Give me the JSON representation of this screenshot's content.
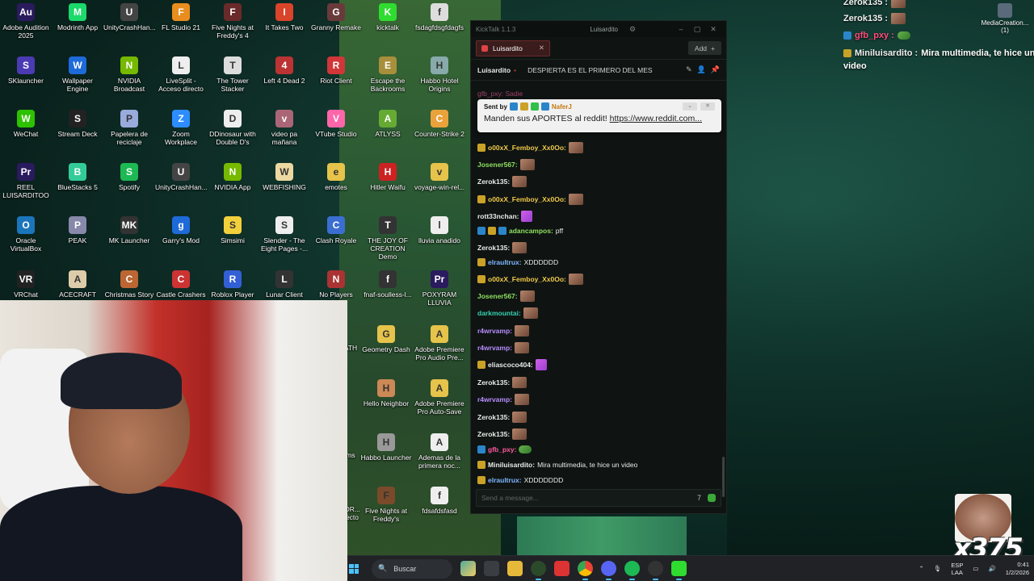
{
  "desktop": {
    "icons": [
      {
        "label": "Adobe Audition 2025",
        "color": "#2a1a5e",
        "glyph": "Au"
      },
      {
        "label": "Modrinth App",
        "color": "#1bd96a",
        "glyph": "M"
      },
      {
        "label": "UnityCrashHan...",
        "color": "#444",
        "glyph": "U"
      },
      {
        "label": "FL Studio 21",
        "color": "#e88d1e",
        "glyph": "F"
      },
      {
        "label": "Five Nights at Freddy's 4",
        "color": "#6b2a2a",
        "glyph": "F"
      },
      {
        "label": "It Takes Two",
        "color": "#d9442a",
        "glyph": "I"
      },
      {
        "label": "Granny Remake",
        "color": "#6a3a3a",
        "glyph": "G"
      },
      {
        "label": "kicktalk",
        "color": "#2fdc2f",
        "glyph": "K"
      },
      {
        "label": "fsdagfdsgfdagfs",
        "color": "#ddd",
        "glyph": "f"
      },
      {
        "label": "SKlauncher",
        "color": "#4b3bb3",
        "glyph": "S"
      },
      {
        "label": "Wallpaper Engine",
        "color": "#1e6ad9",
        "glyph": "W"
      },
      {
        "label": "NVIDIA Broadcast",
        "color": "#76b900",
        "glyph": "N"
      },
      {
        "label": "LiveSplit - Acceso directo",
        "color": "#eee",
        "glyph": "L"
      },
      {
        "label": "The Tower Stacker",
        "color": "#ddd",
        "glyph": "T"
      },
      {
        "label": "Left 4 Dead 2",
        "color": "#b33",
        "glyph": "4"
      },
      {
        "label": "Riot Client",
        "color": "#d13639",
        "glyph": "R"
      },
      {
        "label": "Escape the Backrooms",
        "color": "#a88f3b",
        "glyph": "E"
      },
      {
        "label": "Habbo Hotel Origins",
        "color": "#8aa",
        "glyph": "H"
      },
      {
        "label": "WeChat",
        "color": "#2dc100",
        "glyph": "W"
      },
      {
        "label": "Stream Deck",
        "color": "#222",
        "glyph": "S"
      },
      {
        "label": "Papelera de reciclaje",
        "color": "#9ad",
        "glyph": "P"
      },
      {
        "label": "Zoom Workplace",
        "color": "#2d8cff",
        "glyph": "Z"
      },
      {
        "label": "DDinosaur with Double D's",
        "color": "#eee",
        "glyph": "D"
      },
      {
        "label": "video pa mañana",
        "color": "#a67",
        "glyph": "v"
      },
      {
        "label": "VTube Studio",
        "color": "#f6a",
        "glyph": "V"
      },
      {
        "label": "ATLYSS",
        "color": "#6a3",
        "glyph": "A"
      },
      {
        "label": "Counter-Strike 2",
        "color": "#e9a23b",
        "glyph": "C"
      },
      {
        "label": "REEL LUISARDITOO",
        "color": "#2a1a5e",
        "glyph": "Pr"
      },
      {
        "label": "BlueStacks 5",
        "color": "#3c9",
        "glyph": "B"
      },
      {
        "label": "Spotify",
        "color": "#1db954",
        "glyph": "S"
      },
      {
        "label": "UnityCrashHan...",
        "color": "#444",
        "glyph": "U"
      },
      {
        "label": "NVIDIA App",
        "color": "#76b900",
        "glyph": "N"
      },
      {
        "label": "WEBFISHING",
        "color": "#ecd9a0",
        "glyph": "W"
      },
      {
        "label": "emotes",
        "color": "#e6c34a",
        "glyph": "e"
      },
      {
        "label": "Hitler Waifu",
        "color": "#c22",
        "glyph": "H"
      },
      {
        "label": "voyage-win-rel...",
        "color": "#e6c34a",
        "glyph": "v"
      },
      {
        "label": "Oracle VirtualBox",
        "color": "#1b75bb",
        "glyph": "O"
      },
      {
        "label": "PEAK",
        "color": "#88a",
        "glyph": "P"
      },
      {
        "label": "MK Launcher",
        "color": "#333",
        "glyph": "MK"
      },
      {
        "label": "Garry's Mod",
        "color": "#1e6ad9",
        "glyph": "g"
      },
      {
        "label": "Simsimi",
        "color": "#f2d03b",
        "glyph": "S"
      },
      {
        "label": "Slender - The Eight Pages -...",
        "color": "#eee",
        "glyph": "S"
      },
      {
        "label": "Clash Royale",
        "color": "#3a6fd1",
        "glyph": "C"
      },
      {
        "label": "THE JOY OF CREATION Demo",
        "color": "#333",
        "glyph": "T"
      },
      {
        "label": "lluvia anadido",
        "color": "#eee",
        "glyph": "l"
      },
      {
        "label": "VRChat",
        "color": "#222",
        "glyph": "VR"
      },
      {
        "label": "ACECRAFT",
        "color": "#dca",
        "glyph": "A"
      },
      {
        "label": "Christmas Story",
        "color": "#b63",
        "glyph": "C"
      },
      {
        "label": "Castle Crashers",
        "color": "#c33",
        "glyph": "C"
      },
      {
        "label": "Roblox Player",
        "color": "#335fd6",
        "glyph": "R"
      },
      {
        "label": "Lunar Client",
        "color": "#333",
        "glyph": "L"
      },
      {
        "label": "No Players Online",
        "color": "#a33",
        "glyph": "N"
      },
      {
        "label": "fnaf-soulless-l...",
        "color": "#333",
        "glyph": "f"
      },
      {
        "label": "POXYRAM LLUVIA",
        "color": "#2a1a5e",
        "glyph": "Pr"
      }
    ],
    "icons2": [
      {
        "label": "Geometry Dash",
        "color": "#e6c34a",
        "glyph": "G"
      },
      {
        "label": "Adobe Premiere Pro Audio Pre...",
        "color": "#e6c34a",
        "glyph": "A"
      },
      {
        "label": "Hello Neighbor",
        "color": "#c85",
        "glyph": "H"
      },
      {
        "label": "Adobe Premiere Pro Auto-Save",
        "color": "#e6c34a",
        "glyph": "A"
      },
      {
        "label": "Habbo Launcher",
        "color": "#999",
        "glyph": "H"
      },
      {
        "label": "Ademas de la primera noc...",
        "color": "#eee",
        "glyph": "A"
      },
      {
        "label": "Five Nights at Freddy's",
        "color": "#7a4a2a",
        "glyph": "F"
      },
      {
        "label": "fdsafdsfasd",
        "color": "#eee",
        "glyph": "f"
      }
    ],
    "partial_labels": [
      "ATH",
      "ms",
      "OR... ecto"
    ]
  },
  "kicktalk": {
    "window_title": "KickTalk 1.1.3",
    "user": "Luisardito",
    "tab_label": "Luisardito",
    "add_label": "Add",
    "channel": "Luisardito",
    "stream_title": "DESPIERTA ES EL PRIMERO DEL MES",
    "truncated_top": "gfb_pxy: Sadie",
    "pinned": {
      "sent_by_label": "Sent by",
      "author": "NaferJ",
      "message": "Manden sus APORTES al reddit!",
      "link": "https://www.reddit.com..."
    },
    "messages": [
      {
        "user": "o00xX_Femboy_Xx0Oo:",
        "color": "#f0c84a",
        "badges": [
          "gold"
        ],
        "text": "",
        "emote": "face"
      },
      {
        "user": "Josener567:",
        "color": "#8fe060",
        "badges": [],
        "text": "",
        "emote": "face"
      },
      {
        "user": "Zerok135:",
        "color": "#e8ece9",
        "badges": [],
        "text": "",
        "emote": "face"
      },
      {
        "user": "o00xX_Femboy_Xx0Oo:",
        "color": "#f0c84a",
        "badges": [
          "gold"
        ],
        "text": "",
        "emote": "face"
      },
      {
        "user": "rott33nchan:",
        "color": "#e8ece9",
        "badges": [],
        "text": "",
        "emote": "pink"
      },
      {
        "user": "adancampos:",
        "color": "#8fe060",
        "badges": [
          "blue",
          "gold",
          "blue"
        ],
        "text": "pff",
        "emote": ""
      },
      {
        "user": "Zerok135:",
        "color": "#e8ece9",
        "badges": [],
        "text": "",
        "emote": "face"
      },
      {
        "user": "elraultrux:",
        "color": "#7fb6ff",
        "badges": [
          "gold"
        ],
        "text": "XDDDDDD",
        "emote": ""
      },
      {
        "user": "o00xX_Femboy_Xx0Oo:",
        "color": "#f0c84a",
        "badges": [
          "gold"
        ],
        "text": "",
        "emote": "face"
      },
      {
        "user": "Josener567:",
        "color": "#8fe060",
        "badges": [],
        "text": "",
        "emote": "face"
      },
      {
        "user": "darkmountai:",
        "color": "#36d0b0",
        "badges": [],
        "text": "",
        "emote": "face"
      },
      {
        "user": "r4wrvamp:",
        "color": "#b88cff",
        "badges": [],
        "text": "",
        "emote": "face"
      },
      {
        "user": "r4wrvamp:",
        "color": "#b88cff",
        "badges": [],
        "text": "",
        "emote": "face"
      },
      {
        "user": "eliascoco404:",
        "color": "#e8ece9",
        "badges": [
          "gold"
        ],
        "text": "",
        "emote": "pink"
      },
      {
        "user": "Zerok135:",
        "color": "#e8ece9",
        "badges": [],
        "text": "",
        "emote": "face"
      },
      {
        "user": "r4wrvamp:",
        "color": "#b88cff",
        "badges": [],
        "text": "",
        "emote": "face"
      },
      {
        "user": "Zerok135:",
        "color": "#e8ece9",
        "badges": [],
        "text": "",
        "emote": "face"
      },
      {
        "user": "Zerok135:",
        "color": "#e8ece9",
        "badges": [],
        "text": "",
        "emote": "face"
      },
      {
        "user": "gfb_pxy:",
        "color": "#ff5aa0",
        "badges": [
          "blue"
        ],
        "text": "",
        "emote": "frog"
      },
      {
        "user": "Miniluisardito:",
        "color": "#e8ece9",
        "badges": [
          "gold"
        ],
        "text": "Mira multimedia, te hice un video",
        "emote": ""
      },
      {
        "user": "elraultrux:",
        "color": "#7fb6ff",
        "badges": [
          "gold"
        ],
        "text": "XDDDDDDD",
        "emote": ""
      }
    ],
    "input_placeholder": "Send a message..."
  },
  "overlay": {
    "rows": [
      {
        "user": "Zerok135 :",
        "text": "",
        "color": "#f2f2f2",
        "emote": "face"
      },
      {
        "user": "Zerok135 :",
        "text": "",
        "color": "#f2f2f2",
        "emote": "face"
      },
      {
        "user": "gfb_pxy :",
        "text": "",
        "color": "#ff4d7d",
        "emote": "frog"
      },
      {
        "user": "Miniluisardito :",
        "text": "Mira multimedia, te hice un",
        "color": "#f2f2f2",
        "emote": ""
      },
      {
        "user": "",
        "text": "video",
        "color": "#f2f2f2",
        "emote": ""
      }
    ],
    "media_icon_label": "MediaCreation... (1)"
  },
  "combo": {
    "count": "x375"
  },
  "taskbar": {
    "search_placeholder": "Buscar",
    "lang_top": "ESP",
    "lang_bottom": "LAA",
    "time": "0:41",
    "date": "1/2/2026"
  }
}
